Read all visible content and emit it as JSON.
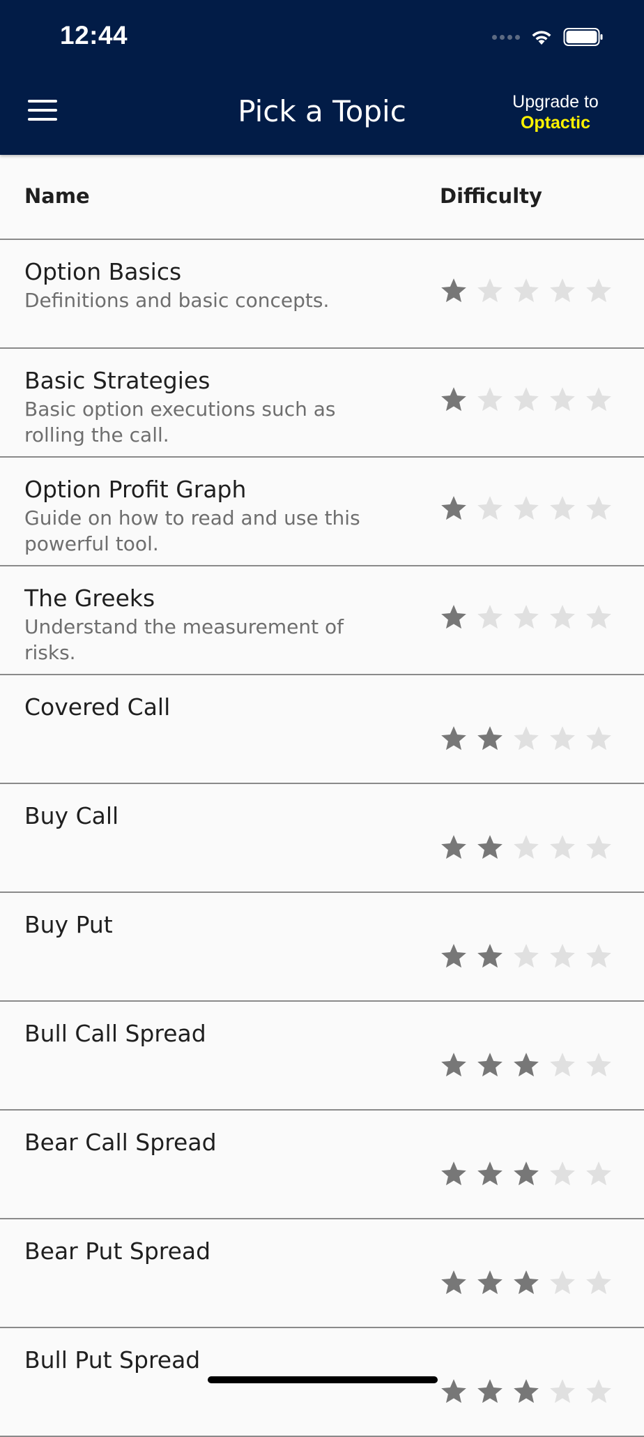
{
  "status_bar": {
    "time": "12:44"
  },
  "nav": {
    "title": "Pick a Topic",
    "upgrade_line1": "Upgrade to",
    "upgrade_line2": "Optactic"
  },
  "colors": {
    "nav_background": "#021c47",
    "upgrade_accent": "#fff200",
    "star_filled": "#777777",
    "star_empty": "#e0e0e0"
  },
  "table": {
    "header_name": "Name",
    "header_difficulty": "Difficulty",
    "max_stars": 5,
    "topics": [
      {
        "title": "Option Basics",
        "description": "Definitions and basic concepts.",
        "difficulty": 1
      },
      {
        "title": "Basic Strategies",
        "description": "Basic option executions such as rolling the call.",
        "difficulty": 1
      },
      {
        "title": "Option Profit Graph",
        "description": "Guide on how to read and use this powerful tool.",
        "difficulty": 1
      },
      {
        "title": "The Greeks",
        "description": "Understand the measurement of risks.",
        "difficulty": 1
      },
      {
        "title": "Covered Call",
        "description": "",
        "difficulty": 2
      },
      {
        "title": "Buy Call",
        "description": "",
        "difficulty": 2
      },
      {
        "title": "Buy Put",
        "description": "",
        "difficulty": 2
      },
      {
        "title": "Bull Call Spread",
        "description": "",
        "difficulty": 3
      },
      {
        "title": "Bear Call Spread",
        "description": "",
        "difficulty": 3
      },
      {
        "title": "Bear Put Spread",
        "description": "",
        "difficulty": 3
      },
      {
        "title": "Bull Put Spread",
        "description": "",
        "difficulty": 3
      }
    ]
  }
}
